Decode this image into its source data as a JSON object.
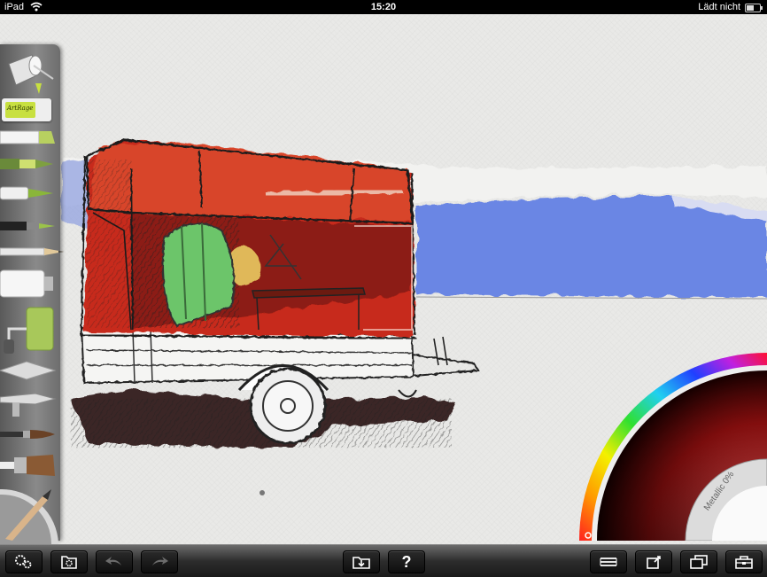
{
  "status_bar": {
    "device": "iPad",
    "time": "15:20",
    "battery_text": "Lädt nicht",
    "battery_level": 0.6
  },
  "tools": [
    {
      "name": "fill-bucket-icon"
    },
    {
      "name": "sticker-icon",
      "label": "ArtRage"
    },
    {
      "name": "eraser-icon"
    },
    {
      "name": "felt-pen-icon"
    },
    {
      "name": "marker-icon"
    },
    {
      "name": "ink-pen-icon"
    },
    {
      "name": "pencil-icon"
    },
    {
      "name": "paint-tube-icon"
    },
    {
      "name": "paint-roller-icon"
    },
    {
      "name": "palette-knife-icon"
    },
    {
      "name": "airbrush-icon"
    },
    {
      "name": "round-brush-icon"
    },
    {
      "name": "flat-brush-icon"
    }
  ],
  "color_picker": {
    "metallic_label": "Metallic 0%",
    "current_color": "#e01818"
  },
  "toolbar": {
    "settings_icon": "gears-icon",
    "canvas_settings_icon": "canvas-gear-icon",
    "undo_icon": "undo-icon",
    "redo_icon": "redo-icon",
    "gallery_icon": "folder-down-icon",
    "help_label": "?",
    "layers_icon": "layers-icon",
    "export_icon": "export-icon",
    "duplicate_icon": "duplicate-icon",
    "tools_icon": "toolbox-icon"
  }
}
